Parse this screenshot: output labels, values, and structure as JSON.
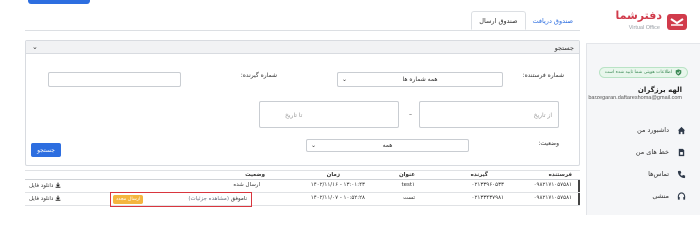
{
  "sidebar": {
    "logo_text": "دفترشما",
    "logo_sub": "Virtual Office",
    "verify_badge": "اطلاعات هویتی شما تایید شده است",
    "user_name": "الهه برزگران",
    "user_email": "barzegaran.daftareshoma@gmail.com",
    "items": [
      {
        "label": "داشبورد من",
        "icon": "home-icon"
      },
      {
        "label": "خط های من",
        "icon": "sim-card-icon"
      },
      {
        "label": "تماس‌ها",
        "icon": "phone-icon"
      },
      {
        "label": "منشی",
        "icon": "headset-icon"
      }
    ]
  },
  "tabs": [
    {
      "label": "صندوق ارسال",
      "active": true
    },
    {
      "label": "صندوق دریافت",
      "active": false
    }
  ],
  "search": {
    "title": "جستجو",
    "sender_label": "شماره فرستنده:",
    "sender_value": "همه شماره ها",
    "receiver_label": "شماره گیرنده:",
    "from_date": "از تاریخ",
    "dash": "–",
    "to_date": "تا تاریخ",
    "status_label": "وضعیت:",
    "status_value": "همه",
    "button": "جستجو"
  },
  "table": {
    "headers": [
      "فرستنده",
      "گیرنده",
      "عنوان",
      "زمان",
      "وضعیت"
    ],
    "rows": [
      {
        "sender": "۰۹۸۲۱۷۱۰۵۷۵۸۱",
        "receiver": "۰۲۱۳۳۹۶۰۵۳۳",
        "title": "test۱",
        "time": "۱۴۰۲/۱۱/۱۶ - ۱۳:۰۱:۴۳",
        "status": "ارسال شده",
        "download": "دانلود فایل"
      },
      {
        "sender": "۰۹۸۲۱۷۱۰۵۷۵۸۱",
        "receiver": "۰۲۱۳۳۴۳۷۹۸۱",
        "title": "تست",
        "time": "۱۴۰۲/۱۱/۰۷ - ۱۰:۵۲:۲۸",
        "status": "ناموفق",
        "status_link": "(مشاهده جزئیات)",
        "resend": "ارسال مجدد",
        "download": "دانلود فایل"
      }
    ]
  },
  "colors": {
    "accent": "#2d6ee0",
    "brand": "#d13b4b",
    "warning": "#f4b53f",
    "highlight": "#d9363e",
    "verified": "#3d8b57"
  }
}
